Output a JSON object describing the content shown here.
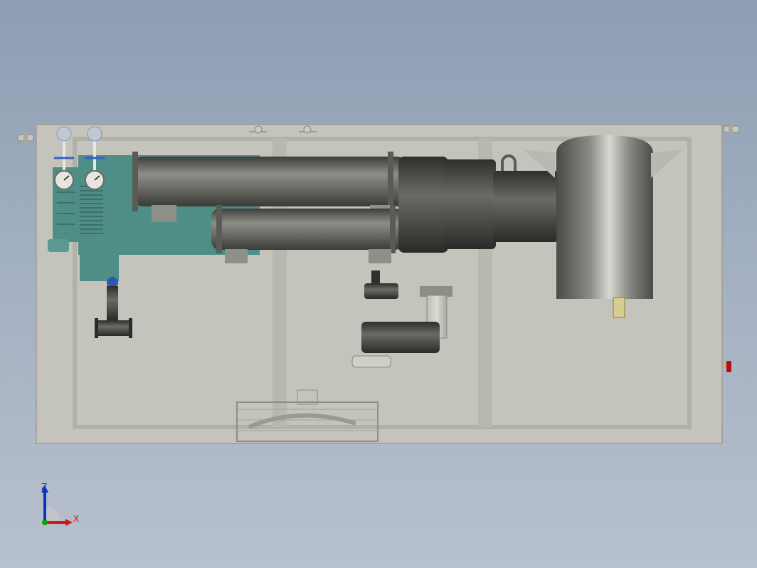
{
  "viewport": {
    "background_top": "#8d9db2",
    "background_bottom": "#b7c0cd",
    "model": {
      "frame_color": "#c4c4bc",
      "frame_edge_color": "#9d9d95",
      "pump_color": "#4e8e86",
      "vessel_color": "#5d5d58",
      "valve_handle_color": "#b01010"
    }
  },
  "triad": {
    "z_label": "Z",
    "x_label": "X",
    "z_color": "#1030c0",
    "x_color": "#d01818",
    "y_color": "#10a010"
  }
}
